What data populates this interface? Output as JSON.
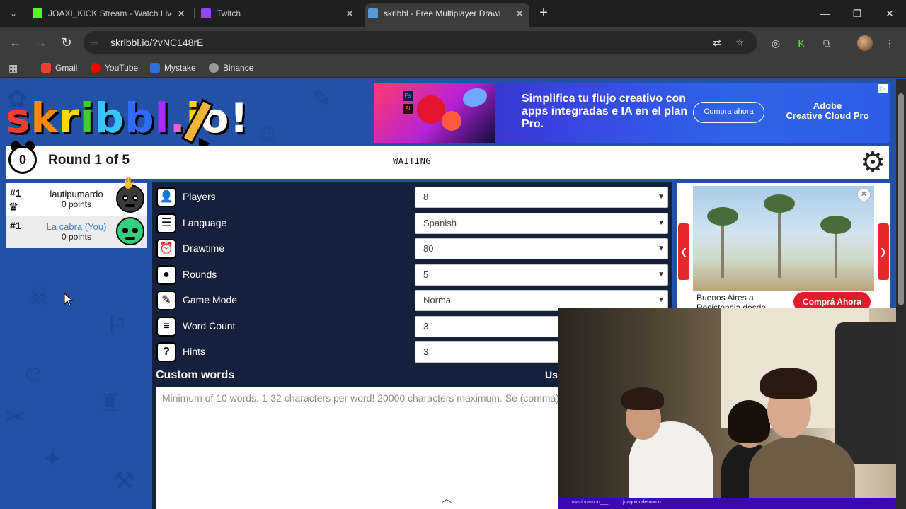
{
  "browser": {
    "tabs": [
      {
        "label": "JOAXI_KICK Stream - Watch Live",
        "close": "✕",
        "favicon_color": "#53fc18"
      },
      {
        "label": "Twitch",
        "close": "✕",
        "favicon_color": "#9146ff"
      },
      {
        "label": "skribbl - Free Multiplayer Drawi",
        "close": "✕",
        "favicon_color": "#5b9bd5"
      }
    ],
    "new_tab": "+",
    "window_controls": {
      "minimize": "—",
      "restore": "❐",
      "close": "✕"
    },
    "url": "skribbl.io/?vNC148rE",
    "bookmarks": [
      {
        "label": "Gmail",
        "color": "#ea4335"
      },
      {
        "label": "YouTube",
        "color": "#ff0000"
      },
      {
        "label": "Mystake",
        "color": "#2f6fd6"
      },
      {
        "label": "Binance",
        "color": "#9a9a9a"
      }
    ]
  },
  "page": {
    "logo": [
      "s",
      "k",
      "r",
      "i",
      "b",
      "b",
      "l",
      ".",
      "i",
      "o",
      "!"
    ],
    "ad_banner": {
      "headline": "Simplifica tu flujo creativo con apps integradas e IA en el plan Pro.",
      "cta": "Compra ahora",
      "brand_top": "Adobe",
      "brand_bottom": "Creative Cloud Pro",
      "info": "▷"
    },
    "header": {
      "timer": "0",
      "round": "Round 1 of 5",
      "status": "WAITING",
      "settings_icon": "⚙"
    },
    "players": [
      {
        "rank": "#1",
        "name": "lautipumardo",
        "points": "0 points",
        "avatar_color": "#3a3a3a",
        "is_you": false
      },
      {
        "rank": "#1",
        "name": "La cabra (You)",
        "points": "0 points",
        "avatar_color": "#35d07f",
        "is_you": true
      }
    ],
    "settings": [
      {
        "label": "Players",
        "value": "8",
        "icon": "👤"
      },
      {
        "label": "Language",
        "value": "Spanish",
        "icon": "☰"
      },
      {
        "label": "Drawtime",
        "value": "80",
        "icon": "⏰"
      },
      {
        "label": "Rounds",
        "value": "5",
        "icon": "●"
      },
      {
        "label": "Game Mode",
        "value": "Normal",
        "icon": "✎"
      },
      {
        "label": "Word Count",
        "value": "3",
        "icon": "≡"
      },
      {
        "label": "Hints",
        "value": "3",
        "icon": "?"
      }
    ],
    "custom_words": {
      "title": "Custom words",
      "use_label": "Us",
      "placeholder": "Minimum of 10 words. 1-32 characters per word! 20000 characters maximum. Se (comma)"
    },
    "side_ad": {
      "text": "Buenos Aires a Resistencia desde",
      "cta": "Comprá Ahora",
      "close": "✕",
      "prev": "❮",
      "next": "❯"
    },
    "scroll_up": "︿",
    "webcam": {
      "names": [
        "maxiocampo___",
        "joaquinndemarco"
      ]
    }
  }
}
